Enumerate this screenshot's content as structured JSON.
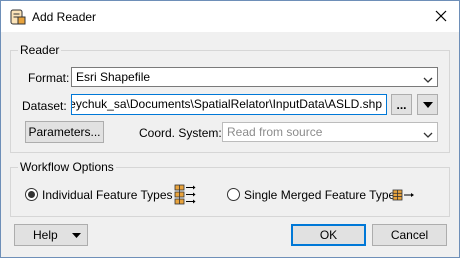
{
  "dialog": {
    "title": "Add Reader",
    "icons": {
      "app": "reader-app-icon",
      "close": "close-icon"
    }
  },
  "reader": {
    "group_label": "Reader",
    "format_label": "Format:",
    "format_value": "Esri Shapefile",
    "dataset_label": "Dataset:",
    "dataset_value": "n.opaleychuk_sa\\Documents\\SpatialRelator\\InputData\\ASLD.shp",
    "browse_label": "...",
    "parameters_label": "Parameters...",
    "coord_label": "Coord. System:",
    "coord_value": "Read from source"
  },
  "workflow": {
    "group_label": "Workflow Options",
    "option_individual": "Individual Feature Types",
    "option_merged": "Single Merged Feature Type",
    "selected": "individual"
  },
  "footer": {
    "help_label": "Help",
    "ok_label": "OK",
    "cancel_label": "Cancel"
  },
  "colors": {
    "accent": "#0078d7",
    "icon_orange": "#e8a33d"
  }
}
